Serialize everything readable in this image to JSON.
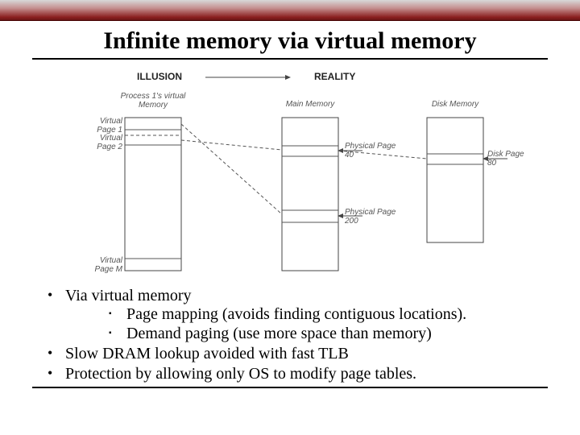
{
  "title": "Infinite memory via virtual memory",
  "figure": {
    "headers": {
      "illusion": "ILLUSION",
      "reality": "REALITY"
    },
    "columns": {
      "virtual": "Process 1's virtual\nMemory",
      "main": "Main Memory",
      "disk": "Disk Memory"
    },
    "labels": {
      "vp1": "Virtual\nPage 1",
      "vp2": "Virtual\nPage 2",
      "vpM": "Virtual\nPage M",
      "pp40": "Physical Page\n40",
      "pp200": "Physical Page\n200",
      "dp80": "Disk Page\n80"
    }
  },
  "bullets": {
    "b1": "Via virtual memory",
    "b1_sub1": "Page mapping (avoids finding contiguous locations).",
    "b1_sub2": "Demand paging (use more space than memory)",
    "b2": "Slow DRAM lookup avoided with fast TLB",
    "b3": "Protection by allowing only OS to modify page tables."
  }
}
